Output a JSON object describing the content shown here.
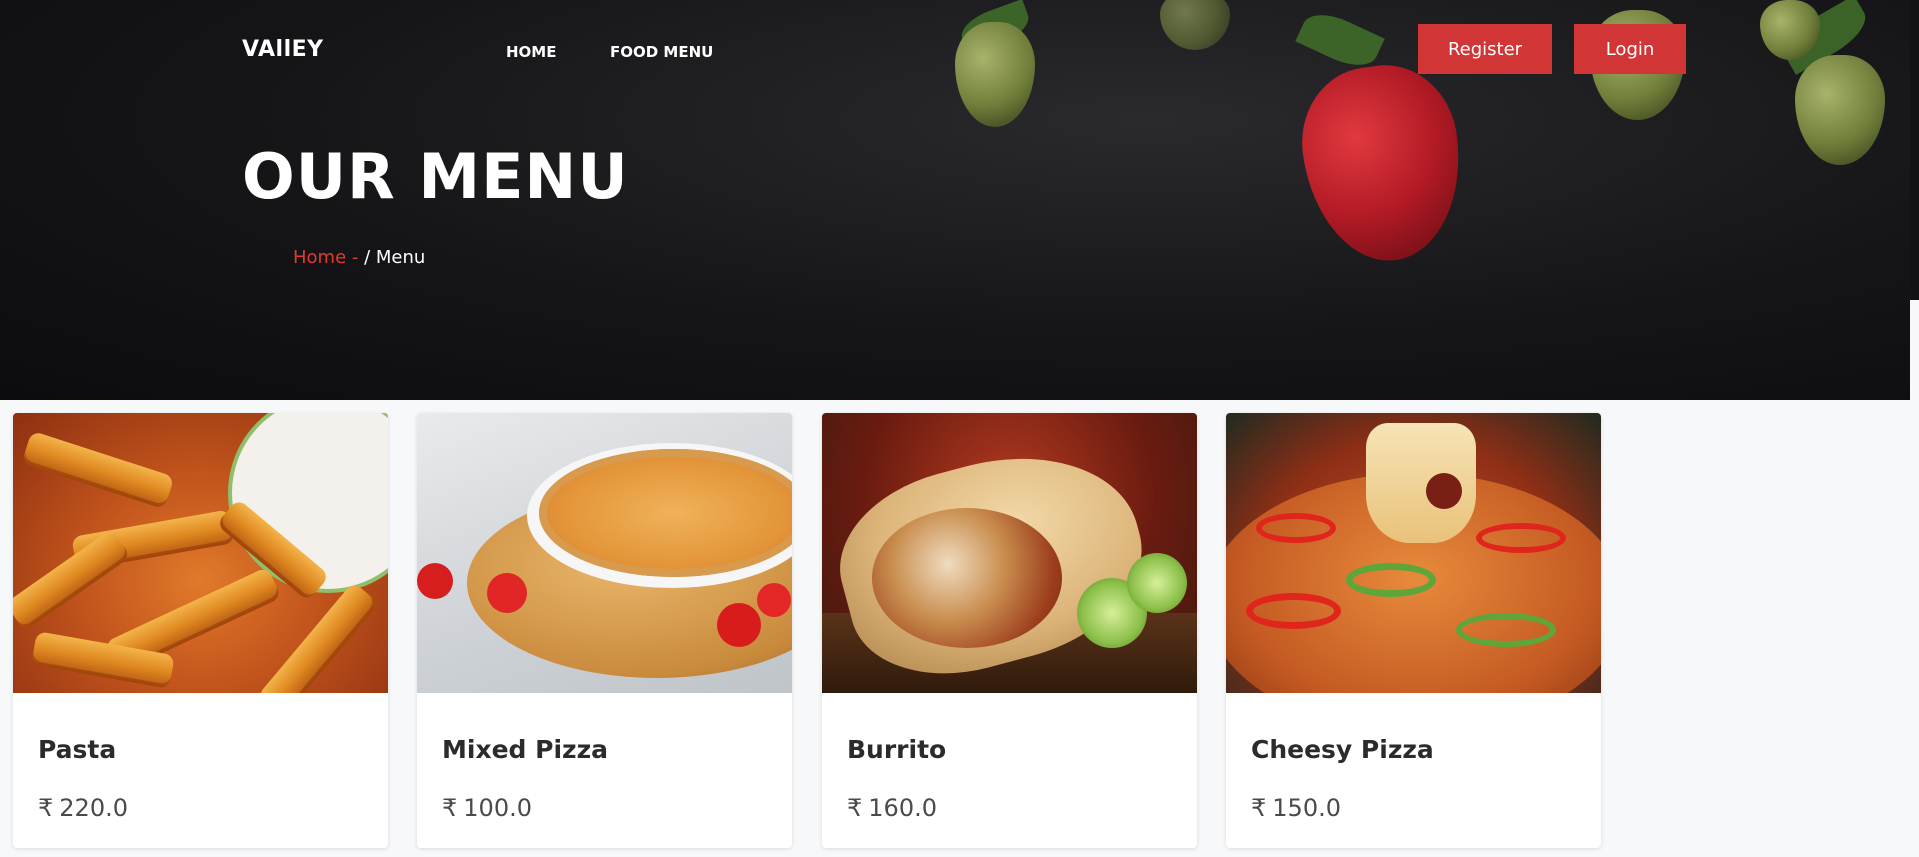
{
  "header": {
    "brand": "VAllEY",
    "nav": [
      "HOME",
      "FOOD MENU"
    ],
    "register_label": "Register",
    "login_label": "Login",
    "accent_color": "#d13535"
  },
  "hero": {
    "title": "OUR MENU",
    "breadcrumb": {
      "home": "Home",
      "separator": " - ",
      "current": "/ Menu"
    }
  },
  "menu": {
    "currency": "₹",
    "items": [
      {
        "name": "Pasta",
        "price": "220.0",
        "image": "pasta-image"
      },
      {
        "name": "Mixed Pizza",
        "price": "100.0",
        "image": "mixed-pizza-image"
      },
      {
        "name": "Burrito",
        "price": "160.0",
        "image": "burrito-image"
      },
      {
        "name": "Cheesy Pizza",
        "price": "150.0",
        "image": "cheesy-pizza-image"
      }
    ]
  }
}
